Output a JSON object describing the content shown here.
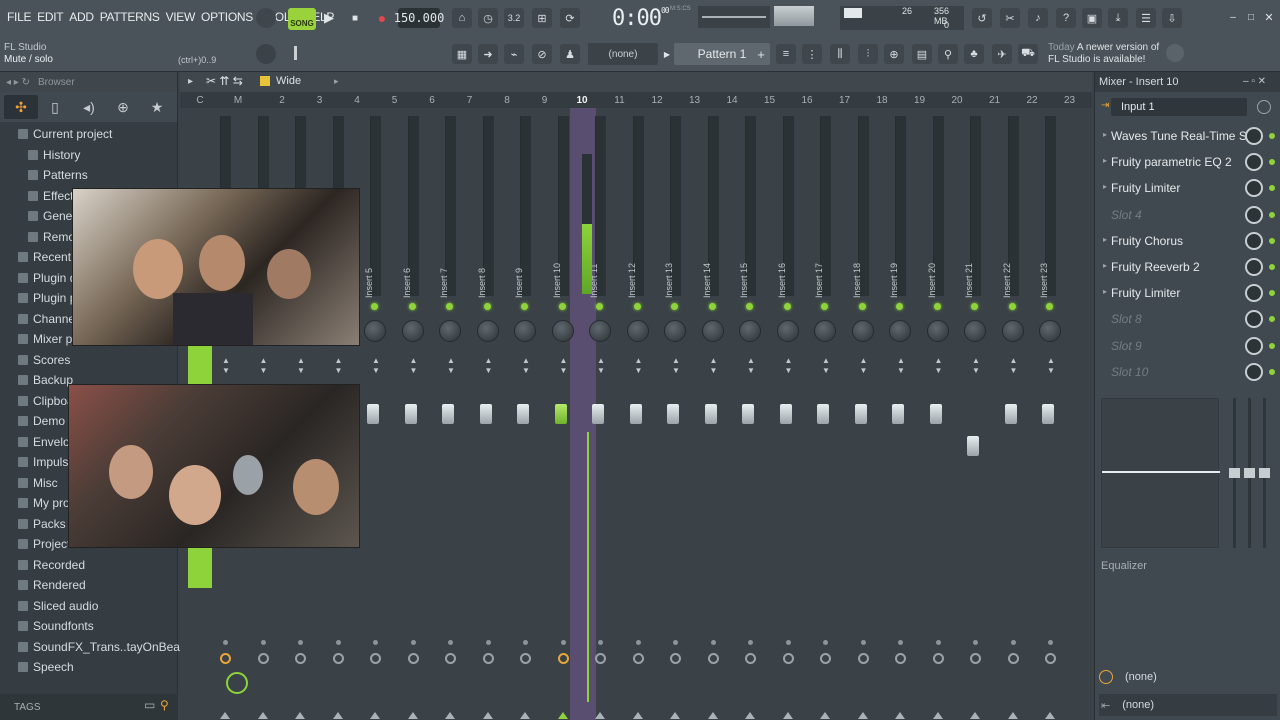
{
  "menu": [
    "FILE",
    "EDIT",
    "ADD",
    "PATTERNS",
    "VIEW",
    "OPTIONS",
    "TOOLS",
    "HELP"
  ],
  "transport": {
    "song_label": "SONG",
    "tempo": "150.000",
    "time": "0:00",
    "time_small": "00",
    "time_unit": "M:S:CS",
    "quantize": "3.2",
    "memory": "356 MB",
    "cpu": "26",
    "poly": "0"
  },
  "hint": {
    "app": "FL Studio",
    "action": "Mute / solo",
    "shortcut": "(ctrl+)0..9"
  },
  "pattern": {
    "none": "(none)",
    "name": "Pattern 1",
    "add": "+"
  },
  "news": {
    "today": "Today",
    "message": "A newer version of",
    "message2": "FL Studio is available!"
  },
  "browser": {
    "title": "Browser",
    "items": [
      {
        "label": "Current project",
        "indent": 0
      },
      {
        "label": "History",
        "indent": 1
      },
      {
        "label": "Patterns",
        "indent": 1
      },
      {
        "label": "Effects",
        "indent": 1
      },
      {
        "label": "Generators",
        "indent": 1
      },
      {
        "label": "Remote control",
        "indent": 1
      },
      {
        "label": "Recent files",
        "indent": 0
      },
      {
        "label": "Plugin database",
        "indent": 0
      },
      {
        "label": "Plugin presets",
        "indent": 0
      },
      {
        "label": "Channel presets",
        "indent": 0
      },
      {
        "label": "Mixer presets",
        "indent": 0
      },
      {
        "label": "Scores",
        "indent": 0
      },
      {
        "label": "Backup",
        "indent": 0
      },
      {
        "label": "Clipboard files",
        "indent": 0
      },
      {
        "label": "Demo projects",
        "indent": 0
      },
      {
        "label": "Envelopes",
        "indent": 0
      },
      {
        "label": "Impulses",
        "indent": 0
      },
      {
        "label": "Misc",
        "indent": 0
      },
      {
        "label": "My projects",
        "indent": 0
      },
      {
        "label": "Packs",
        "indent": 0
      },
      {
        "label": "Project bones",
        "indent": 0
      },
      {
        "label": "Recorded",
        "indent": 0
      },
      {
        "label": "Rendered",
        "indent": 0
      },
      {
        "label": "Sliced audio",
        "indent": 0
      },
      {
        "label": "Soundfonts",
        "indent": 0
      },
      {
        "label": "SoundFX_Trans..tayOnBeat_com",
        "indent": 0
      },
      {
        "label": "Speech",
        "indent": 0
      }
    ],
    "tags": "TAGS"
  },
  "mixer": {
    "view_mode": "Wide",
    "ruler_letters": [
      "C",
      "M"
    ],
    "ruler": [
      "2",
      "3",
      "4",
      "5",
      "6",
      "7",
      "8",
      "9",
      "10",
      "11",
      "12",
      "13",
      "14",
      "15",
      "16",
      "17",
      "18",
      "19",
      "20",
      "21",
      "22",
      "23"
    ],
    "selected_insert": "10",
    "inserts": [
      "Insert 5",
      "Insert 6",
      "Insert 7",
      "Insert 8",
      "Insert 9",
      "Insert 10",
      "Insert 11",
      "Insert 12",
      "Insert 13",
      "Insert 14",
      "Insert 15",
      "Insert 16",
      "Insert 17",
      "Insert 18",
      "Insert 19",
      "Insert 20",
      "Insert 21",
      "Insert 22",
      "Insert 23"
    ]
  },
  "right_panel": {
    "title": "Mixer - Insert 10",
    "input": "Input 1",
    "slots": [
      {
        "name": "Waves Tune Real-Time S..",
        "empty": false
      },
      {
        "name": "Fruity parametric EQ 2",
        "empty": false
      },
      {
        "name": "Fruity Limiter",
        "empty": false
      },
      {
        "name": "Slot 4",
        "empty": true
      },
      {
        "name": "Fruity Chorus",
        "empty": false
      },
      {
        "name": "Fruity Reeverb 2",
        "empty": false
      },
      {
        "name": "Fruity Limiter",
        "empty": false
      },
      {
        "name": "Slot 8",
        "empty": true
      },
      {
        "name": "Slot 9",
        "empty": true
      },
      {
        "name": "Slot 10",
        "empty": true
      }
    ],
    "eq_label": "Equalizer",
    "out_a": "(none)",
    "out_b": "(none)"
  },
  "colors": {
    "accent": "#8ed33a",
    "selected_strip": "#9664be",
    "orange": "#e8a63a"
  }
}
